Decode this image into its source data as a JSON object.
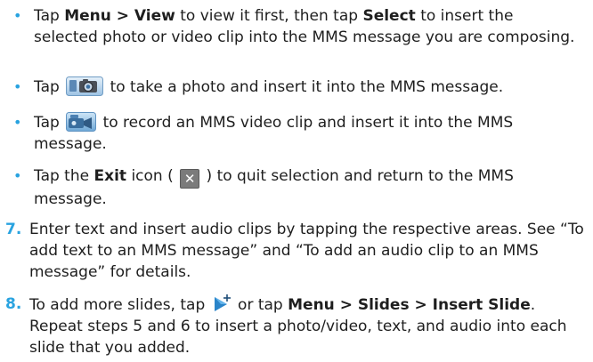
{
  "colors": {
    "accent": "#29a3e0",
    "text": "#1e1e1e"
  },
  "bullet_glyph": "•",
  "bullets": [
    {
      "parts": {
        "a": "Tap ",
        "b": "Menu > View",
        "c": " to view it first, then tap ",
        "d": "Select",
        "e": " to insert the selected photo or video clip into the MMS message you are composing."
      }
    },
    {
      "icon": "camera-icon",
      "parts": {
        "a": "Tap ",
        "b": " to take a photo and insert it into the MMS message."
      }
    },
    {
      "icon": "video-camera-icon",
      "parts": {
        "a": "Tap ",
        "b": " to record an MMS video clip and insert it into the MMS message."
      }
    },
    {
      "icon": "exit-icon",
      "parts": {
        "a": "Tap the ",
        "b": "Exit",
        "c": " icon ( ",
        "d": " ) to quit selection and return to the MMS message."
      }
    }
  ],
  "steps": [
    {
      "number": "7.",
      "text": "Enter text and insert audio clips by tapping the respective areas. See “To add text to an MMS message” and “To add an audio clip to an MMS message” for details."
    },
    {
      "number": "8.",
      "icon": "insert-slide-icon",
      "parts": {
        "a": "To add more slides, tap ",
        "b": " or tap ",
        "c": "Menu > Slides > Insert Slide",
        "d": ". Repeat steps 5 and 6 to insert a photo/video, text, and audio into each slide that you added."
      }
    }
  ]
}
